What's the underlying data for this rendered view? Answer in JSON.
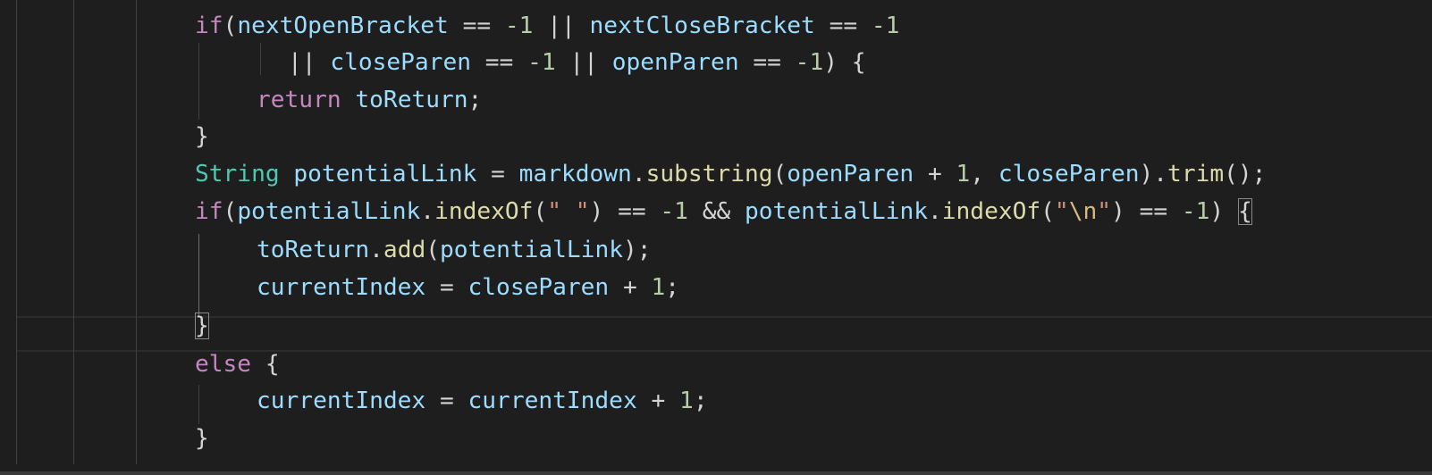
{
  "editor": {
    "language": "java",
    "theme_colors": {
      "background": "#1e1e1e",
      "keyword": "#c586c0",
      "type": "#4ec9b0",
      "variable": "#9cdcfe",
      "function": "#dcdcaa",
      "number": "#b5cea8",
      "string": "#ce9178",
      "punctuation": "#d4d4d4"
    },
    "lines": [
      {
        "tokens": [
          {
            "t": "if",
            "c": "kw"
          },
          {
            "t": "(",
            "c": "p"
          },
          {
            "t": "nextOpenBracket",
            "c": "var"
          },
          {
            "t": " == ",
            "c": "p"
          },
          {
            "t": "-1",
            "c": "num"
          },
          {
            "t": " || ",
            "c": "p"
          },
          {
            "t": "nextCloseBracket",
            "c": "var"
          },
          {
            "t": " == ",
            "c": "p"
          },
          {
            "t": "-1",
            "c": "num"
          }
        ]
      },
      {
        "tokens": [
          {
            "t": "|| ",
            "c": "p"
          },
          {
            "t": "closeParen",
            "c": "var"
          },
          {
            "t": " == ",
            "c": "p"
          },
          {
            "t": "-1",
            "c": "num"
          },
          {
            "t": " || ",
            "c": "p"
          },
          {
            "t": "openParen",
            "c": "var"
          },
          {
            "t": " == ",
            "c": "p"
          },
          {
            "t": "-1",
            "c": "num"
          },
          {
            "t": ") {",
            "c": "p"
          }
        ]
      },
      {
        "tokens": [
          {
            "t": "return",
            "c": "kw"
          },
          {
            "t": " ",
            "c": "p"
          },
          {
            "t": "toReturn",
            "c": "var"
          },
          {
            "t": ";",
            "c": "p"
          }
        ]
      },
      {
        "tokens": [
          {
            "t": "}",
            "c": "p"
          }
        ]
      },
      {
        "tokens": [
          {
            "t": "String",
            "c": "type"
          },
          {
            "t": " ",
            "c": "p"
          },
          {
            "t": "potentialLink",
            "c": "var"
          },
          {
            "t": " = ",
            "c": "p"
          },
          {
            "t": "markdown",
            "c": "var"
          },
          {
            "t": ".",
            "c": "p"
          },
          {
            "t": "substring",
            "c": "fn"
          },
          {
            "t": "(",
            "c": "p"
          },
          {
            "t": "openParen",
            "c": "var"
          },
          {
            "t": " + ",
            "c": "p"
          },
          {
            "t": "1",
            "c": "num"
          },
          {
            "t": ", ",
            "c": "p"
          },
          {
            "t": "closeParen",
            "c": "var"
          },
          {
            "t": ").",
            "c": "p"
          },
          {
            "t": "trim",
            "c": "fn"
          },
          {
            "t": "();",
            "c": "p"
          }
        ]
      },
      {
        "tokens": [
          {
            "t": "if",
            "c": "kw"
          },
          {
            "t": "(",
            "c": "p"
          },
          {
            "t": "potentialLink",
            "c": "var"
          },
          {
            "t": ".",
            "c": "p"
          },
          {
            "t": "indexOf",
            "c": "fn"
          },
          {
            "t": "(",
            "c": "p"
          },
          {
            "t": "\" \"",
            "c": "str"
          },
          {
            "t": ") == ",
            "c": "p"
          },
          {
            "t": "-1",
            "c": "num"
          },
          {
            "t": " && ",
            "c": "p"
          },
          {
            "t": "potentialLink",
            "c": "var"
          },
          {
            "t": ".",
            "c": "p"
          },
          {
            "t": "indexOf",
            "c": "fn"
          },
          {
            "t": "(",
            "c": "p"
          },
          {
            "t": "\"",
            "c": "str"
          },
          {
            "t": "\\n",
            "c": "esc"
          },
          {
            "t": "\"",
            "c": "str"
          },
          {
            "t": ") == ",
            "c": "p"
          },
          {
            "t": "-1",
            "c": "num"
          },
          {
            "t": ") ",
            "c": "p"
          },
          {
            "t": "{",
            "c": "p",
            "box": true
          }
        ]
      },
      {
        "tokens": [
          {
            "t": "toReturn",
            "c": "var"
          },
          {
            "t": ".",
            "c": "p"
          },
          {
            "t": "add",
            "c": "fn"
          },
          {
            "t": "(",
            "c": "p"
          },
          {
            "t": "potentialLink",
            "c": "var"
          },
          {
            "t": ");",
            "c": "p"
          }
        ]
      },
      {
        "tokens": [
          {
            "t": "currentIndex",
            "c": "var"
          },
          {
            "t": " = ",
            "c": "p"
          },
          {
            "t": "closeParen",
            "c": "var"
          },
          {
            "t": " + ",
            "c": "p"
          },
          {
            "t": "1",
            "c": "num"
          },
          {
            "t": ";",
            "c": "p"
          }
        ]
      },
      {
        "tokens": [
          {
            "t": "}",
            "c": "p",
            "box": true
          }
        ]
      },
      {
        "tokens": [
          {
            "t": "else",
            "c": "kw"
          },
          {
            "t": " {",
            "c": "p"
          }
        ]
      },
      {
        "tokens": [
          {
            "t": "currentIndex",
            "c": "var"
          },
          {
            "t": " = ",
            "c": "p"
          },
          {
            "t": "currentIndex",
            "c": "var"
          },
          {
            "t": " + ",
            "c": "p"
          },
          {
            "t": "1",
            "c": "num"
          },
          {
            "t": ";",
            "c": "p"
          }
        ]
      },
      {
        "tokens": [
          {
            "t": "}",
            "c": "p"
          }
        ]
      }
    ]
  }
}
